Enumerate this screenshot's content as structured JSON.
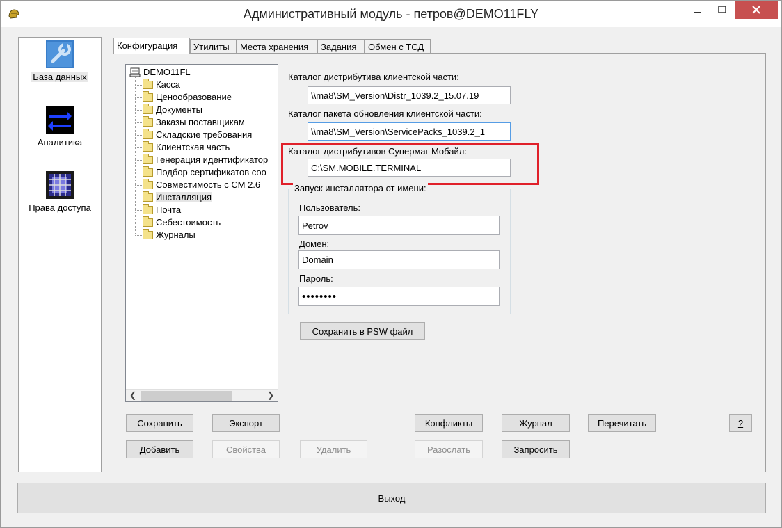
{
  "window": {
    "title": "Административный модуль - петров@DEMO11FLY",
    "icon": "app-helmet-icon",
    "controls": [
      "minimize",
      "maximize",
      "close"
    ]
  },
  "sidebar": {
    "items": [
      {
        "label": "База данных",
        "icon": "database-wrench-icon",
        "selected": true
      },
      {
        "label": "Аналитика",
        "icon": "exchange-arrows-icon",
        "selected": false
      },
      {
        "label": "Права доступа",
        "icon": "access-rights-icon",
        "selected": false
      }
    ]
  },
  "tabs": [
    {
      "label": "Конфигурация",
      "active": true
    },
    {
      "label": "Утилиты",
      "active": false
    },
    {
      "label": "Места хранения",
      "active": false
    },
    {
      "label": "Задания",
      "active": false
    },
    {
      "label": "Обмен с ТСД",
      "active": false
    }
  ],
  "tree": {
    "root": "DEMO11FL",
    "root_icon": "computer-icon",
    "items": [
      {
        "label": "Касса"
      },
      {
        "label": "Ценообразование"
      },
      {
        "label": "Документы"
      },
      {
        "label": "Заказы поставщикам"
      },
      {
        "label": "Складские требования"
      },
      {
        "label": "Клиентская часть"
      },
      {
        "label": "Генерация идентификатор"
      },
      {
        "label": "Подбор сертификатов соо"
      },
      {
        "label": "Совместимость с СМ 2.6"
      },
      {
        "label": "Инсталляция",
        "selected": true
      },
      {
        "label": "Почта"
      },
      {
        "label": "Себестоимость"
      },
      {
        "label": "Журналы"
      }
    ]
  },
  "form": {
    "client_distr_label": "Каталог дистрибутива клиентской части:",
    "client_distr_value": "\\\\ma8\\SM_Version\\Distr_1039.2_15.07.19",
    "client_update_label": "Каталог пакета обновления клиентской части:",
    "client_update_value": "\\\\ma8\\SM_Version\\ServicePacks_1039.2_1",
    "mobile_distr_label": "Каталог дистрибутивов Супермаг Мобайл:",
    "mobile_distr_value": "C:\\SM.MOBILE.TERMINAL",
    "installer_group_title": "Запуск инсталлятора от имени:",
    "user_label": "Пользователь:",
    "user_value": "Petrov",
    "domain_label": "Домен:",
    "domain_value": "Domain",
    "password_label": "Пароль:",
    "password_value": "••••••••",
    "save_psw_button": "Сохранить в PSW файл"
  },
  "buttons": {
    "save": "Сохранить",
    "export": "Экспорт",
    "conflicts": "Конфликты",
    "journal": "Журнал",
    "reread": "Перечитать",
    "help": "?",
    "add": "Добавить",
    "properties": "Свойства",
    "delete": "Удалить",
    "send": "Разослать",
    "request": "Запросить",
    "exit": "Выход"
  },
  "colors": {
    "highlight": "#e0202a",
    "close_button": "#c75050",
    "panel_bg": "#f0f0f0"
  }
}
